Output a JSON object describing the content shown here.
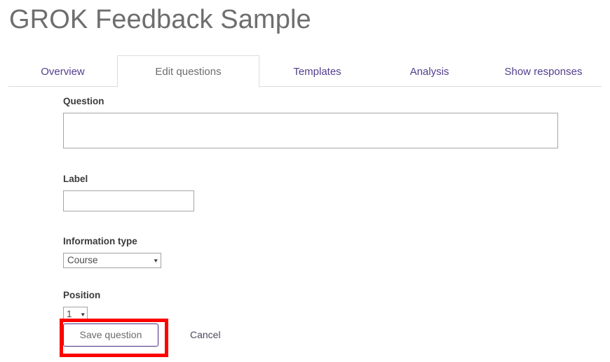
{
  "header": {
    "title": "GROK Feedback Sample"
  },
  "tabs": [
    {
      "id": "overview",
      "label": "Overview",
      "active": false
    },
    {
      "id": "edit",
      "label": "Edit questions",
      "active": true
    },
    {
      "id": "templates",
      "label": "Templates",
      "active": false
    },
    {
      "id": "analysis",
      "label": "Analysis",
      "active": false
    },
    {
      "id": "responses",
      "label": "Show responses",
      "active": false
    }
  ],
  "form": {
    "question": {
      "label": "Question",
      "value": "",
      "placeholder": ""
    },
    "label_field": {
      "label": "Label",
      "value": "",
      "placeholder": ""
    },
    "information_type": {
      "label": "Information type",
      "value": "Course",
      "caret": "▾",
      "options": [
        "Course"
      ]
    },
    "position": {
      "label": "Position",
      "value": "1",
      "caret": "▾",
      "options": [
        "1"
      ]
    }
  },
  "actions": {
    "save_label": "Save question",
    "cancel_label": "Cancel"
  },
  "annotation": {
    "color": "#fe0000",
    "target": "save-question-button"
  },
  "colors": {
    "title": "#6e6e6e",
    "tab_link": "#513e8c",
    "tab_active_text": "#6d6d6d",
    "label_text": "#3b3b3b",
    "input_border": "#a6a6a6",
    "button_border": "#4b2d7f",
    "annotation_red": "#fe0000"
  }
}
